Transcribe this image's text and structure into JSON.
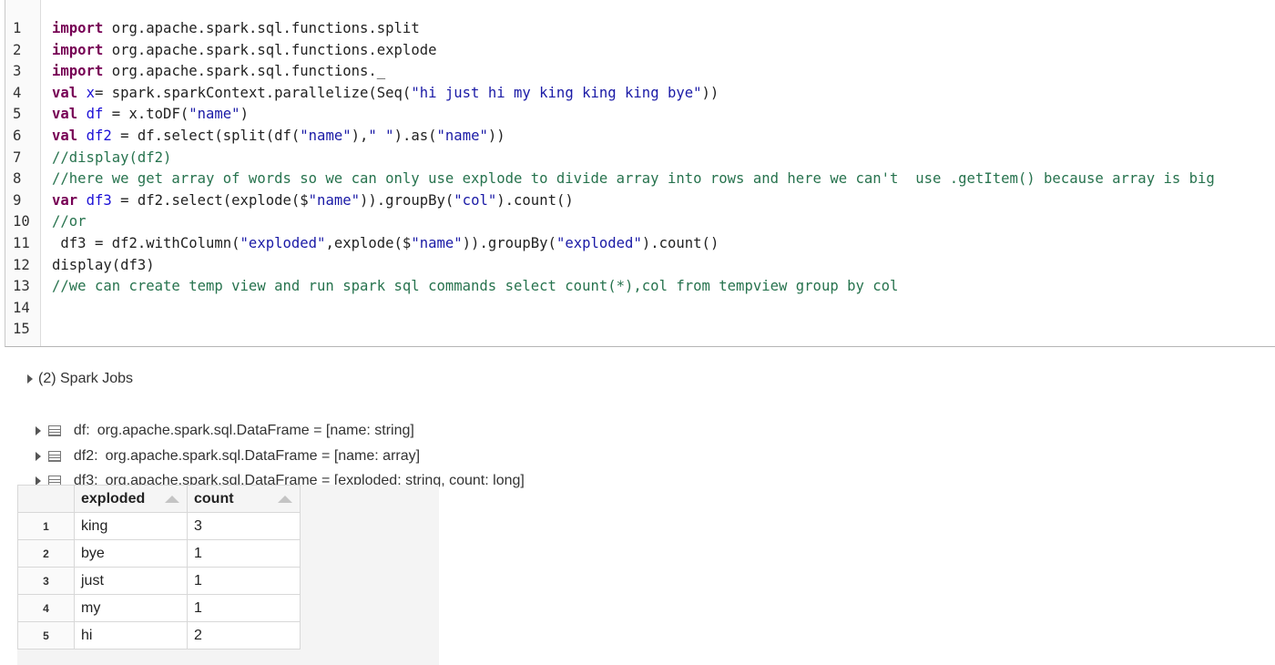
{
  "code": {
    "lines": [
      {
        "n": "1",
        "html": "<span class=\"kw\">import</span> org.apache.spark.sql.functions.split"
      },
      {
        "n": "2",
        "html": "<span class=\"kw\">import</span> org.apache.spark.sql.functions.explode"
      },
      {
        "n": "3",
        "html": "<span class=\"kw\">import</span> org.apache.spark.sql.functions._<span class=\"cursor\"></span>"
      },
      {
        "n": "4",
        "html": "<span class=\"kw\">val</span> <span class=\"var\">x</span>= spark.sparkContext.parallelize(Seq(<span class=\"str\">\"hi just hi my king king king bye\"</span>))"
      },
      {
        "n": "5",
        "html": "<span class=\"kw\">val</span> <span class=\"var\">df</span> = x.toDF(<span class=\"str\">\"name\"</span>)"
      },
      {
        "n": "6",
        "html": "<span class=\"kw\">val</span> <span class=\"var\">df2</span> = df.select(split(df(<span class=\"str\">\"name\"</span>),<span class=\"str\">\" \"</span>).as(<span class=\"str\">\"name\"</span>))"
      },
      {
        "n": "7",
        "html": "<span class=\"cmt\">//display(df2)</span>"
      },
      {
        "n": "8",
        "html": "<span class=\"cmt\">//here we get array of words so we can only use explode to divide array into rows and here we can't  use .getItem() because array is big</span>"
      },
      {
        "n": "9",
        "html": "<span class=\"kw\">var</span> <span class=\"var\">df3</span> = df2.select(explode($<span class=\"str\">\"name\"</span>)).groupBy(<span class=\"str\">\"col\"</span>).count()"
      },
      {
        "n": "10",
        "html": "<span class=\"cmt\">//or</span>"
      },
      {
        "n": "11",
        "html": " df3 = df2.withColumn(<span class=\"str\">\"exploded\"</span>,explode($<span class=\"str\">\"name\"</span>)).groupBy(<span class=\"str\">\"exploded\"</span>).count()"
      },
      {
        "n": "12",
        "html": "display(df3)"
      },
      {
        "n": "13",
        "html": "<span class=\"cmt\">//we can create temp view and run spark sql commands select count(*),col from tempview group by col</span>"
      },
      {
        "n": "14",
        "html": ""
      },
      {
        "n": "15",
        "html": ""
      }
    ]
  },
  "output": {
    "spark_jobs": "(2) Spark Jobs",
    "dataframes": [
      {
        "name": "df:",
        "type": "org.apache.spark.sql.DataFrame = [name: string]"
      },
      {
        "name": "df2:",
        "type": "org.apache.spark.sql.DataFrame = [name: array]"
      },
      {
        "name": "df3:",
        "type": "org.apache.spark.sql.DataFrame = [exploded: string, count: long]"
      }
    ]
  },
  "table": {
    "headers": [
      "exploded",
      "count"
    ],
    "rows": [
      {
        "idx": "1",
        "exploded": "king",
        "count": "3"
      },
      {
        "idx": "2",
        "exploded": "bye",
        "count": "1"
      },
      {
        "idx": "3",
        "exploded": "just",
        "count": "1"
      },
      {
        "idx": "4",
        "exploded": "my",
        "count": "1"
      },
      {
        "idx": "5",
        "exploded": "hi",
        "count": "2"
      }
    ]
  }
}
